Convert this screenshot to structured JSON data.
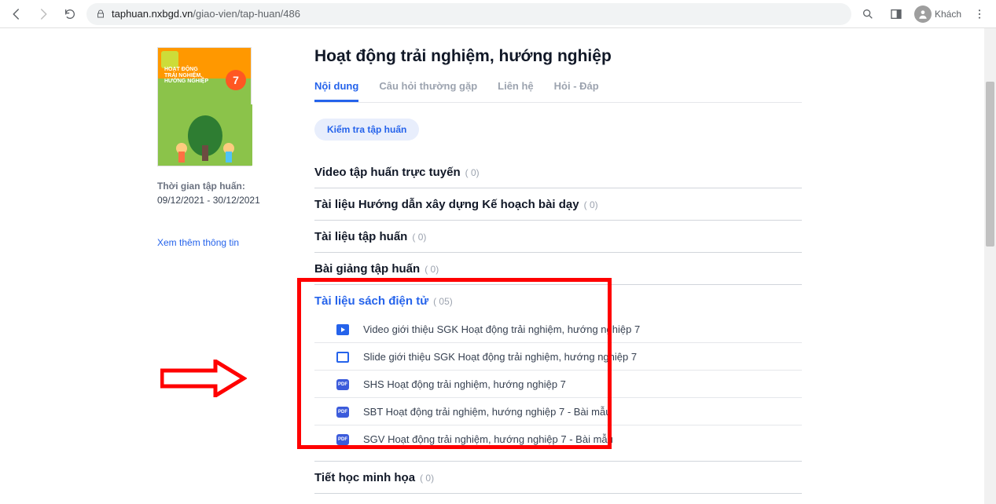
{
  "browser": {
    "url_domain": "taphuan.nxbgd.vn",
    "url_path": "/giao-vien/tap-huan/486",
    "guest_label": "Khách"
  },
  "book": {
    "grade_badge": "7",
    "cover_line1": "HOẠT ĐỘNG",
    "cover_line2": "TRẢI NGHIỆM,",
    "cover_line3": "HƯỚNG NGHIỆP"
  },
  "left": {
    "time_label": "Thời gian tập huấn:",
    "time_value": "09/12/2021 - 30/12/2021",
    "more_link": "Xem thêm thông tin"
  },
  "page_title": "Hoạt động trải nghiệm, hướng nghiệp",
  "tabs": [
    {
      "label": "Nội dung",
      "active": true
    },
    {
      "label": "Câu hỏi thường gặp",
      "active": false
    },
    {
      "label": "Liên hệ",
      "active": false
    },
    {
      "label": "Hỏi - Đáp",
      "active": false
    }
  ],
  "check_button": "Kiểm tra tập huấn",
  "sections": [
    {
      "title": "Video tập huấn trực tuyến",
      "count": "( 0)"
    },
    {
      "title": "Tài liệu Hướng dẫn xây dựng Kế hoạch bài dạy",
      "count": "( 0)"
    },
    {
      "title": "Tài liệu tập huấn",
      "count": "( 0)"
    },
    {
      "title": "Bài giảng tập huấn",
      "count": "( 0)"
    },
    {
      "title": "Tài liệu sách điện tử",
      "count": "( 05)",
      "expanded": true,
      "items": [
        {
          "icon": "video",
          "label": "Video giới thiệu SGK Hoạt động trải nghiệm, hướng nghiệp 7"
        },
        {
          "icon": "slide",
          "label": "Slide giới thiệu SGK Hoạt động trải nghiệm, hướng nghiệp 7"
        },
        {
          "icon": "pdf",
          "label": "SHS Hoạt động trải nghiệm, hướng nghiệp 7"
        },
        {
          "icon": "pdf",
          "label": "SBT Hoạt động trải nghiệm, hướng nghiệp 7 - Bài mẫu"
        },
        {
          "icon": "pdf",
          "label": "SGV Hoạt động trải nghiệm, hướng nghiệp 7 - Bài mẫu"
        }
      ]
    },
    {
      "title": "Tiết học minh họa",
      "count": "( 0)"
    }
  ]
}
